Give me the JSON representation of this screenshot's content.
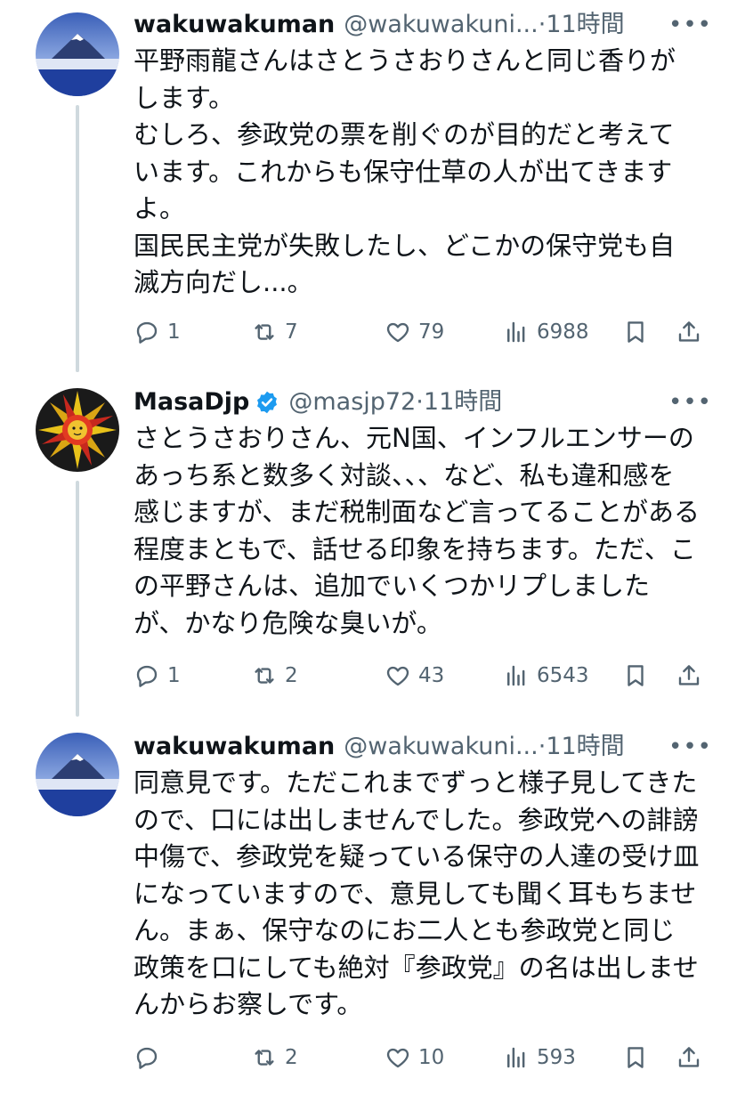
{
  "tweets": [
    {
      "name": "wakuwakuman",
      "handle": "@wakuwakuni...",
      "sep": "·",
      "time": "11時間",
      "verified": false,
      "text": "平野雨龍さんはさとうさおりさんと同じ香りがします。\nむしろ、参政党の票を削ぐのが目的だと考えています。これからも保守仕草の人が出てきますよ。\n国民民主党が失敗したし、どこかの保守党も自滅方向だし...。",
      "replies": "1",
      "retweets": "7",
      "likes": "79",
      "views": "6988"
    },
    {
      "name": "MasaDjp",
      "handle": "@masjp72",
      "sep": "·",
      "time": "11時間",
      "verified": true,
      "text": "さとうさおりさん、元N国、インフルエンサーのあっち系と数多く対談、、、など、私も違和感を感じますが、まだ税制面など言ってることがある程度まともで、話せる印象を持ちます。ただ、この平野さんは、追加でいくつかリプしましたが、かなり危険な臭いが。",
      "replies": "1",
      "retweets": "2",
      "likes": "43",
      "views": "6543"
    },
    {
      "name": "wakuwakuman",
      "handle": "@wakuwakuni...",
      "sep": "·",
      "time": "11時間",
      "verified": false,
      "text": "同意見です。ただこれまでずっと様子見してきたので、口には出しませんでした。参政党への誹謗中傷で、参政党を疑っている保守の人達の受け皿になっていますので、意見しても聞く耳もちません。まぁ、保守なのにお二人とも参政党と同じ政策を口にしても絶対『参政党』の名は出しませんからお察しです。",
      "replies": "",
      "retweets": "2",
      "likes": "10",
      "views": "593"
    }
  ],
  "more_label": "•••",
  "colors": {
    "text": "#0f1419",
    "secondary": "#536471",
    "verified": "#1d9bf0",
    "thread": "#cfd9de"
  }
}
